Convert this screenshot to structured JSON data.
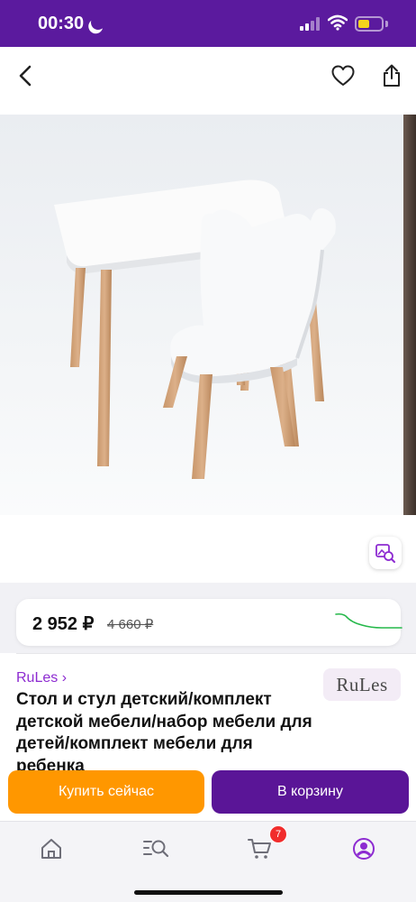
{
  "status_bar": {
    "time": "00:30",
    "background": "#5b1a9e",
    "icons": [
      "moon-icon",
      "cellular-signal-icon",
      "wifi-icon",
      "battery-icon"
    ],
    "battery_level": 0.35
  },
  "header": {
    "icons": [
      "back-arrow-icon",
      "heart-icon",
      "share-icon"
    ]
  },
  "product": {
    "image_description_icon": "visual-search-icon",
    "price": {
      "current": "2 952 ₽",
      "old": "4 660 ₽",
      "trend_color": "#25b84a"
    },
    "brand_link": "RuLes ›",
    "brand_logo_text": "RuLes",
    "title": "Стол и стул детский/комплект детской мебели/набор мебели для детей/комплект мебели для ребенка"
  },
  "actions": {
    "buy_now": "Купить сейчас",
    "add_to_cart": "В корзину",
    "buy_now_color": "#ff9700",
    "add_to_cart_color": "#5a1597"
  },
  "tab_bar": {
    "items": [
      "home-icon",
      "catalog-search-icon",
      "cart-icon",
      "profile-icon"
    ],
    "cart_count": "7",
    "active_color": "#8d2bd1"
  }
}
